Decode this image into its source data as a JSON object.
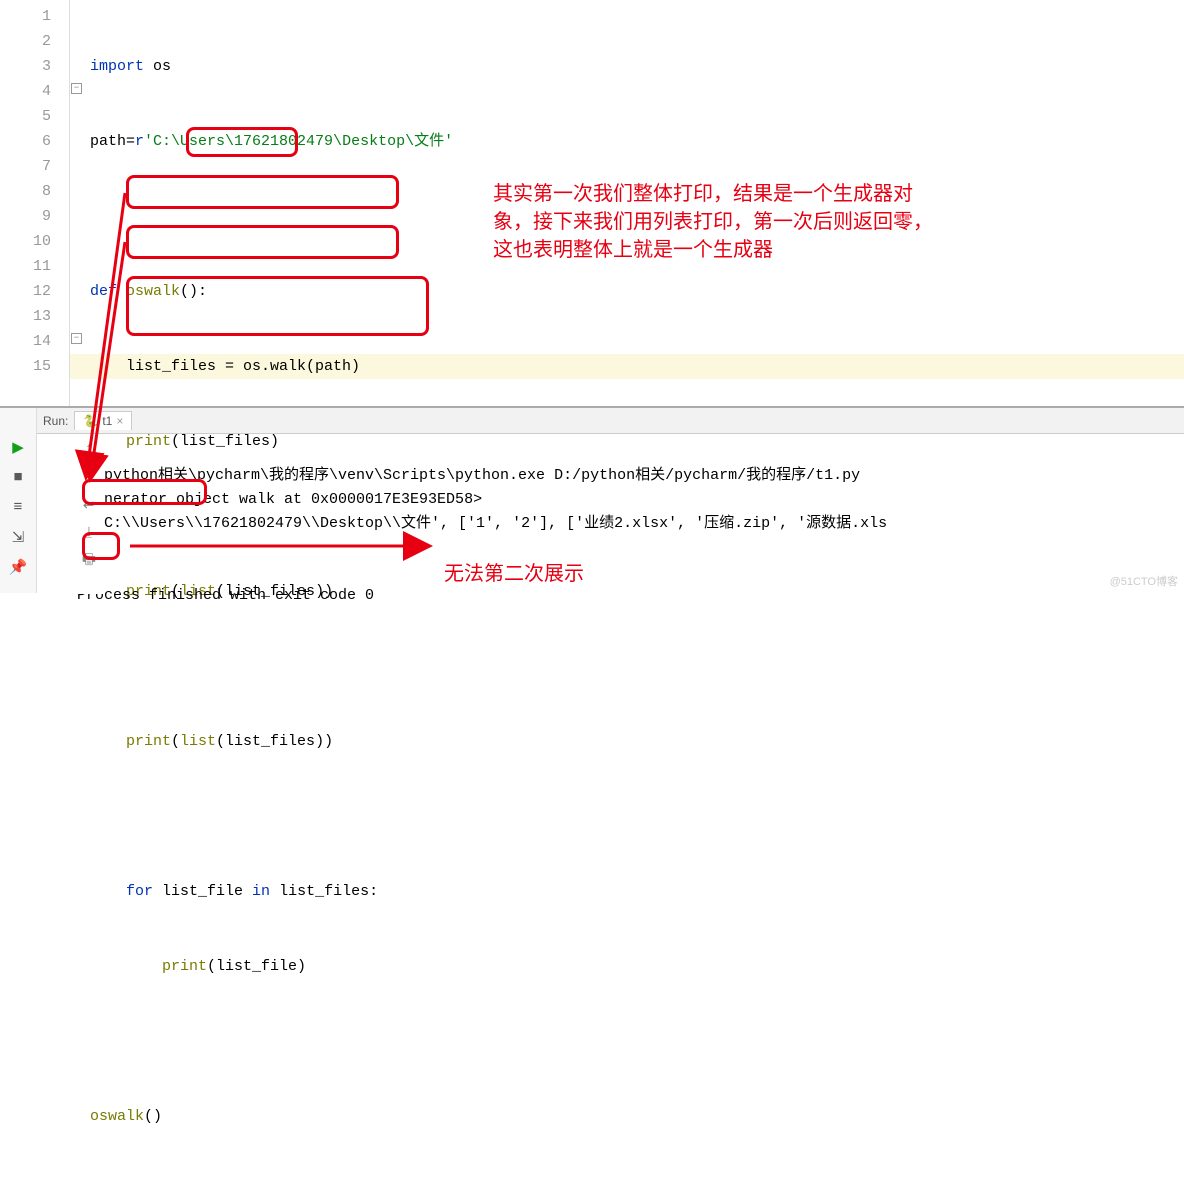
{
  "editor": {
    "line_numbers": [
      "1",
      "2",
      "3",
      "4",
      "5",
      "6",
      "7",
      "8",
      "9",
      "10",
      "11",
      "12",
      "13",
      "14",
      "15"
    ],
    "code": {
      "l1_kw": "import",
      "l1_mod": " os",
      "l2_a": "path=",
      "l2_kw": "r",
      "l2_str": "'C:\\Users\\17621802479\\Desktop\\文件'",
      "l4_kw": "def",
      "l4_fn": " oswalk",
      "l4_p": "():",
      "l5": "    list_files = os.walk(path)",
      "l6_fn": "    print",
      "l6_p1": "(",
      "l6_arg": "list_files",
      "l6_p2": ")",
      "l8_fn": "    print",
      "l8_p1": "(",
      "l8_fn2": "list",
      "l8_p2": "(list_files))",
      "l10_fn": "    print",
      "l10_p1": "(",
      "l10_fn2": "list",
      "l10_p2": "(list_files))",
      "l12_kw": "    for",
      "l12_a": " list_file ",
      "l12_kw2": "in",
      "l12_b": " list_files:",
      "l13_fn": "        print",
      "l13_p": "(list_file)",
      "l15_fn": "oswalk",
      "l15_p": "()"
    }
  },
  "annotations": {
    "main_1": "其实第一次我们整体打印，结果是一个生成器对",
    "main_2": "象，接下来我们用列表打印，第一次后则返回零，",
    "main_3": "这也表明整体上就是一个生成器",
    "second": "无法第二次展示"
  },
  "run": {
    "label": "Run:",
    "tab_name": "t1",
    "cmd": "D:\\python相关\\pycharm\\我的程序\\venv\\Scripts\\python.exe D:/python相关/pycharm/我的程序/t1.py",
    "out_gen": "<generator object walk at 0x0000017E3E93ED58>",
    "out_list": "[('C:\\\\Users\\\\17621802479\\\\Desktop\\\\文件', ['1', '2'], ['业绩2.xlsx', '压缩.zip', '源数据.xls",
    "out_empty": "[]",
    "exit": "Process finished with exit code 0"
  },
  "watermark": "@51CTO博客"
}
